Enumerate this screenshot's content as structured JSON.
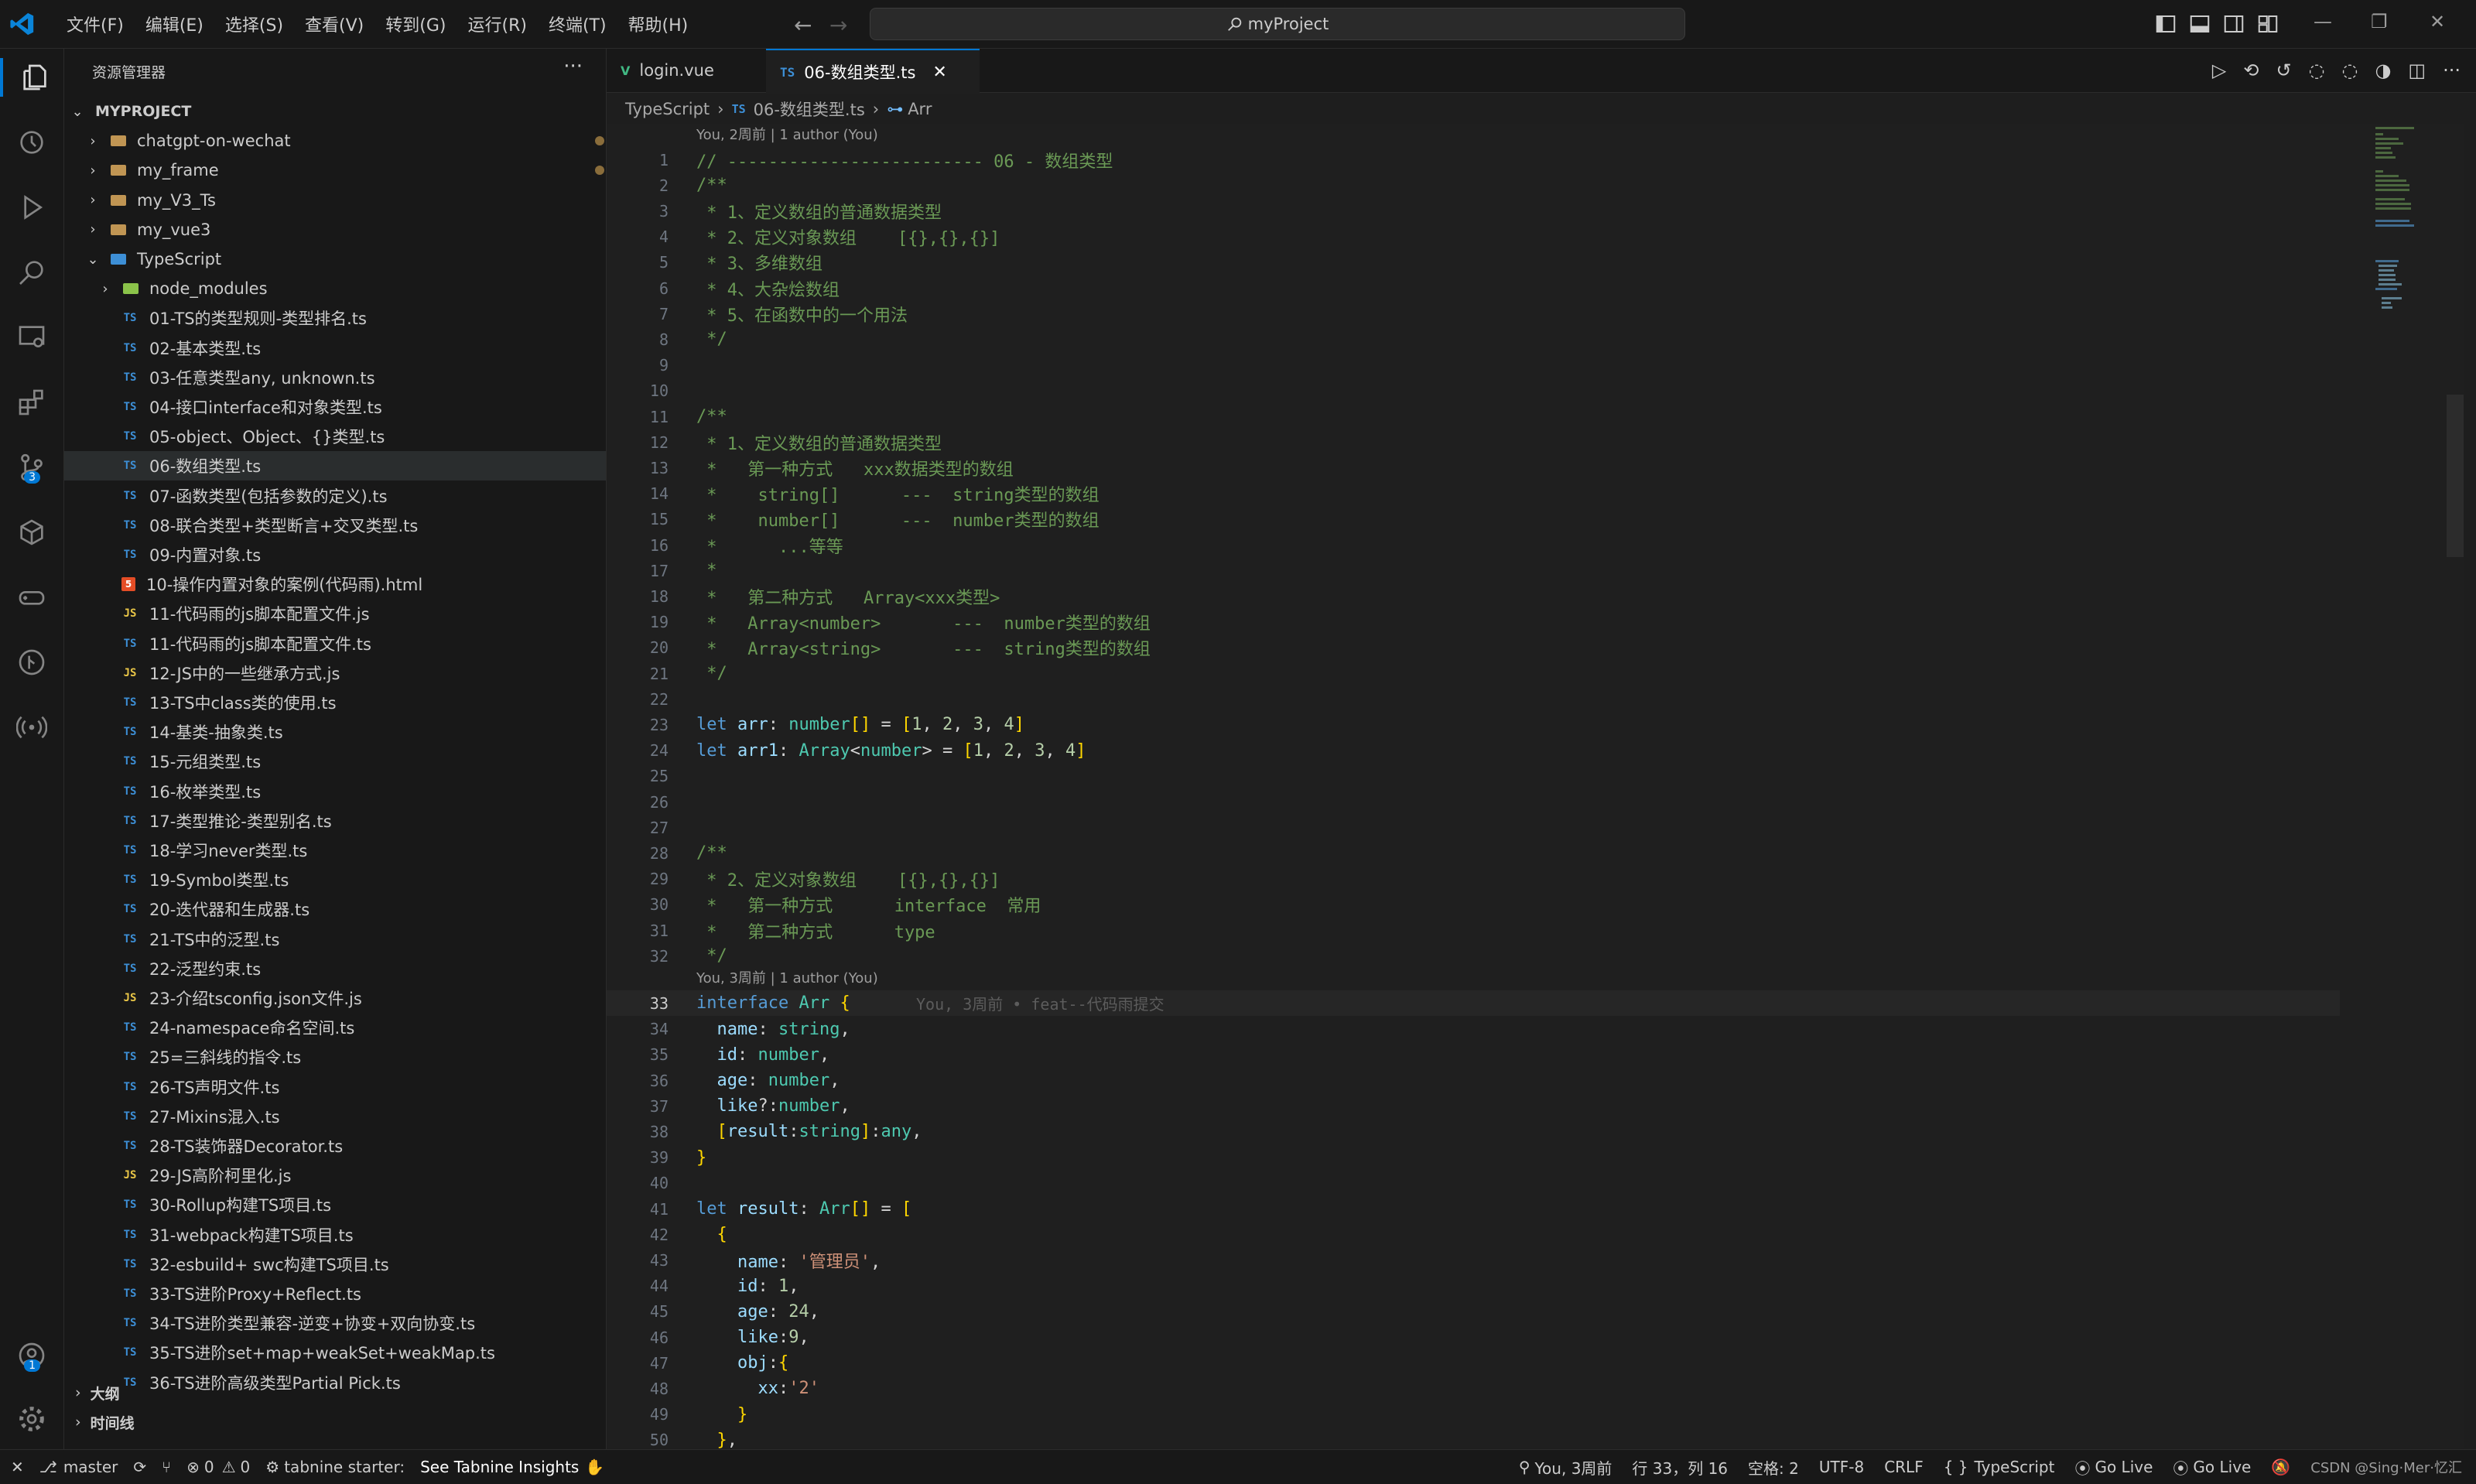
{
  "window": {
    "title": "myProject"
  },
  "menu": [
    "文件(F)",
    "编辑(E)",
    "选择(S)",
    "查看(V)",
    "转到(G)",
    "运行(R)",
    "终端(T)",
    "帮助(H)"
  ],
  "sidebar": {
    "title": "资源管理器",
    "root": "MYPROJECT",
    "folders": [
      {
        "name": "chatgpt-on-wechat",
        "modified": true
      },
      {
        "name": "my_frame",
        "modified": true
      },
      {
        "name": "my_V3_Ts",
        "modified": false
      },
      {
        "name": "my_vue3",
        "modified": false
      },
      {
        "name": "TypeScript",
        "modified": false
      }
    ],
    "subfolder": "node_modules",
    "files": [
      {
        "type": "TS",
        "name": "01-TS的类型规则-类型排名.ts"
      },
      {
        "type": "TS",
        "name": "02-基本类型.ts"
      },
      {
        "type": "TS",
        "name": "03-任意类型any, unknown.ts"
      },
      {
        "type": "TS",
        "name": "04-接口interface和对象类型.ts"
      },
      {
        "type": "TS",
        "name": "05-object、Object、{}类型.ts"
      },
      {
        "type": "TS",
        "name": "06-数组类型.ts"
      },
      {
        "type": "TS",
        "name": "07-函数类型(包括参数的定义).ts"
      },
      {
        "type": "TS",
        "name": "08-联合类型+类型断言+交叉类型.ts"
      },
      {
        "type": "TS",
        "name": "09-内置对象.ts"
      },
      {
        "type": "HTML",
        "name": "10-操作内置对象的案例(代码雨).html"
      },
      {
        "type": "JS",
        "name": "11-代码雨的js脚本配置文件.js"
      },
      {
        "type": "TS",
        "name": "11-代码雨的js脚本配置文件.ts"
      },
      {
        "type": "JS",
        "name": "12-JS中的一些继承方式.js"
      },
      {
        "type": "TS",
        "name": "13-TS中class类的使用.ts"
      },
      {
        "type": "TS",
        "name": "14-基类-抽象类.ts"
      },
      {
        "type": "TS",
        "name": "15-元组类型.ts"
      },
      {
        "type": "TS",
        "name": "16-枚举类型.ts"
      },
      {
        "type": "TS",
        "name": "17-类型推论-类型别名.ts"
      },
      {
        "type": "TS",
        "name": "18-学习never类型.ts"
      },
      {
        "type": "TS",
        "name": "19-Symbol类型.ts"
      },
      {
        "type": "TS",
        "name": "20-迭代器和生成器.ts"
      },
      {
        "type": "TS",
        "name": "21-TS中的泛型.ts"
      },
      {
        "type": "TS",
        "name": "22-泛型约束.ts"
      },
      {
        "type": "JS",
        "name": "23-介绍tsconfig.json文件.js"
      },
      {
        "type": "TS",
        "name": "24-namespace命名空间.ts"
      },
      {
        "type": "TS",
        "name": "25=三斜线的指令.ts"
      },
      {
        "type": "TS",
        "name": "26-TS声明文件.ts"
      },
      {
        "type": "TS",
        "name": "27-Mixins混入.ts"
      },
      {
        "type": "TS",
        "name": "28-TS装饰器Decorator.ts"
      },
      {
        "type": "JS",
        "name": "29-JS高阶柯里化.js"
      },
      {
        "type": "TS",
        "name": "30-Rollup构建TS项目.ts"
      },
      {
        "type": "TS",
        "name": "31-webpack构建TS项目.ts"
      },
      {
        "type": "TS",
        "name": "32-esbuild+ swc构建TS项目.ts"
      },
      {
        "type": "TS",
        "name": "33-TS进阶Proxy+Reflect.ts"
      },
      {
        "type": "TS",
        "name": "34-TS进阶类型兼容-逆变+协变+双向协变.ts"
      },
      {
        "type": "TS",
        "name": "35-TS进阶set+map+weakSet+weakMap.ts"
      },
      {
        "type": "TS",
        "name": "36-TS进阶高级类型Partial Pick.ts"
      }
    ],
    "sections": [
      "大纲",
      "时间线"
    ]
  },
  "tabs": [
    {
      "label": "login.vue",
      "icon": "V"
    },
    {
      "label": "06-数组类型.ts",
      "icon": "TS"
    }
  ],
  "breadcrumb": {
    "folder": "TypeScript",
    "file_icon": "TS",
    "file": "06-数组类型.ts",
    "symbol": "Arr"
  },
  "codelens": [
    {
      "after_line": 0,
      "text": "You, 2周前 | 1 author (You)"
    },
    {
      "after_line": 32,
      "text": "You, 3周前 | 1 author (You)"
    }
  ],
  "blame": "You, 3周前 • feat--代码雨提交",
  "code_lines": [
    "// ------------------------- 06 - 数组类型",
    "/**",
    " * 1、定义数组的普通数据类型",
    " * 2、定义对象数组    [{},{},{}]",
    " * 3、多维数组",
    " * 4、大杂烩数组",
    " * 5、在函数中的一个用法",
    " */",
    "",
    "",
    "/**",
    " * 1、定义数组的普通数据类型",
    " *   第一种方式   xxx数据类型的数组",
    " *    string[]      ---  string类型的数组",
    " *    number[]      ---  number类型的数组",
    " *      ...等等",
    " *",
    " *   第二种方式   Array<xxx类型>",
    " *   Array<number>       ---  number类型的数组",
    " *   Array<string>       ---  string类型的数组",
    " */",
    "",
    "let arr: number[] = [1, 2, 3, 4]",
    "let arr1: Array<number> = [1, 2, 3, 4]",
    "",
    "",
    "",
    "/**",
    " * 2、定义对象数组    [{},{},{}]",
    " *   第一种方式      interface  常用",
    " *   第二种方式      type",
    " */",
    "interface Arr {",
    "  name: string,",
    "  id: number,",
    "  age: number,",
    "  like?:number,",
    "  [result:string]:any,",
    "}",
    "",
    "let result: Arr[] = [",
    "  {",
    "    name: '管理员',",
    "    id: 1,",
    "    age: 24,",
    "    like:9,",
    "    obj:{",
    "      xx:'2'",
    "    }",
    "  },"
  ],
  "current_line": 33,
  "status": {
    "branch": "master",
    "errors": "0",
    "warnings": "0",
    "tabnine": "tabnine starter:",
    "tabnine_link": "See Tabnine Insights",
    "blame": "You, 3周前",
    "position": "行 33，列 16",
    "spaces": "空格: 2",
    "encoding": "UTF-8",
    "eol": "CRLF",
    "language": "TypeScript",
    "golive1": "Go Live",
    "golive2": "Go Live",
    "watermark": "CSDN @Sing·Mer·忆汇"
  },
  "colors": {
    "accent": "#0078d4",
    "ts": "#3d8fd6",
    "js": "#e8c547",
    "comment": "#6a9955",
    "keyword": "#569cd6"
  }
}
